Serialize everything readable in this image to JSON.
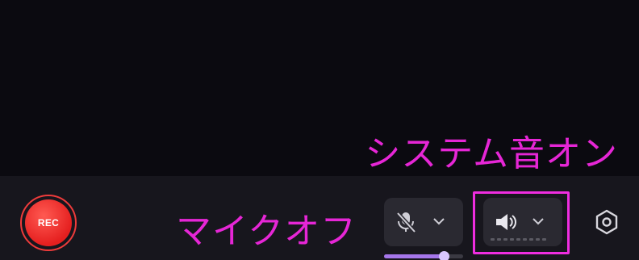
{
  "annotations": {
    "system_sound_on": "システム音オン",
    "mic_off": "マイクオフ"
  },
  "toolbar": {
    "rec_label": "REC",
    "microphone": {
      "state": "muted",
      "icon": "microphone-muted-icon",
      "volume_fraction": 0.76
    },
    "system_audio": {
      "state": "on",
      "icon": "speaker-icon",
      "meter_segments": 9
    },
    "settings_icon": "gear-icon"
  },
  "colors": {
    "annotation": "#e626d6",
    "rec_red": "#e51f1f",
    "volume_accent": "#a576ea",
    "toolbar_bg": "#17161d",
    "control_bg": "#2a2931"
  }
}
